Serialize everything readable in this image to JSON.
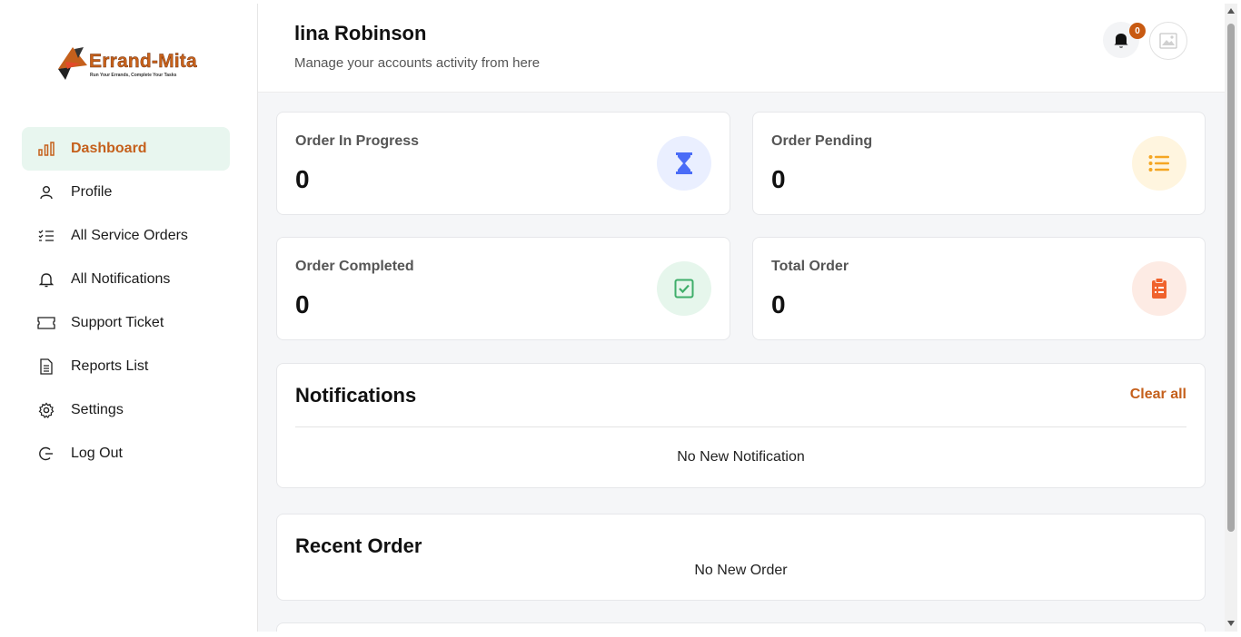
{
  "brand": {
    "name": "Errand-Mita",
    "tagline": "Run Your Errands, Complete Your Tasks"
  },
  "sidebar": {
    "items": [
      {
        "label": "Dashboard",
        "icon": "bar-chart-icon",
        "active": true
      },
      {
        "label": "Profile",
        "icon": "user-icon"
      },
      {
        "label": "All Service Orders",
        "icon": "checklist-icon"
      },
      {
        "label": "All Notifications",
        "icon": "bell-icon"
      },
      {
        "label": "Support Ticket",
        "icon": "ticket-icon"
      },
      {
        "label": "Reports List",
        "icon": "document-icon"
      },
      {
        "label": "Settings",
        "icon": "gear-icon"
      },
      {
        "label": "Log Out",
        "icon": "logout-icon"
      }
    ]
  },
  "header": {
    "title": "lina Robinson",
    "subtitle": "Manage your accounts activity from here",
    "notification_count": "0"
  },
  "stats": [
    {
      "label": "Order In Progress",
      "value": "0",
      "icon": "hourglass-icon",
      "color": "#4a6cf7",
      "bg": "#eaefff"
    },
    {
      "label": "Order Pending",
      "value": "0",
      "icon": "list-icon",
      "color": "#f5a623",
      "bg": "#fff5df"
    },
    {
      "label": "Order Completed",
      "value": "0",
      "icon": "check-square-icon",
      "color": "#3fae6a",
      "bg": "#e6f6ec"
    },
    {
      "label": "Total Order",
      "value": "0",
      "icon": "clipboard-icon",
      "color": "#f0622d",
      "bg": "#fdebe4"
    }
  ],
  "notifications": {
    "title": "Notifications",
    "clear_label": "Clear all",
    "empty_text": "No New Notification"
  },
  "recent_order": {
    "title": "Recent Order",
    "empty_text": "No New Order"
  },
  "colors": {
    "accent": "#c5601c",
    "active_bg": "#e8f6ef"
  }
}
